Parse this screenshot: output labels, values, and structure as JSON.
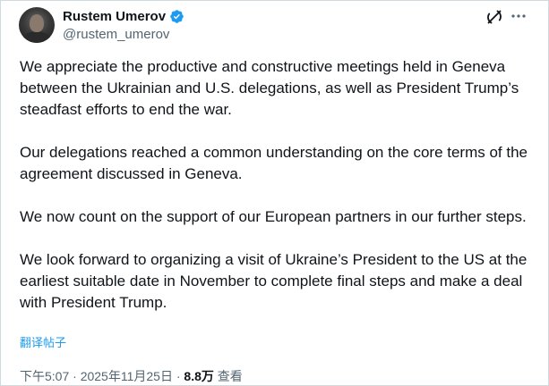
{
  "author": {
    "display_name": "Rustem Umerov",
    "handle": "@rustem_umerov",
    "verified": true
  },
  "tweet": {
    "paragraphs": [
      "We appreciate the productive and constructive meetings held in Geneva between the Ukrainian and U.S. delegations, as well as President Trump’s steadfast efforts to end the war.",
      "Our delegations reached a common understanding on the core terms of the agreement discussed in Geneva.",
      "We now count on the support of our European partners in our further steps.",
      "We look forward to organizing a visit of Ukraine’s President to the US at the earliest suitable date in November to complete final steps and make a deal with President Trump."
    ],
    "translate_label": "翻译帖子",
    "time": "下午5:07",
    "separator": "·",
    "date": "2025年11月25日",
    "views_count": "8.8万",
    "views_label": "查看"
  },
  "icons": {
    "verified": "verified-badge-icon",
    "grok": "grok-icon",
    "more": "more-options-icon"
  },
  "colors": {
    "accent": "#1d9bf0",
    "text_primary": "#0f1419",
    "text_secondary": "#536471",
    "border": "#cfd9de"
  }
}
